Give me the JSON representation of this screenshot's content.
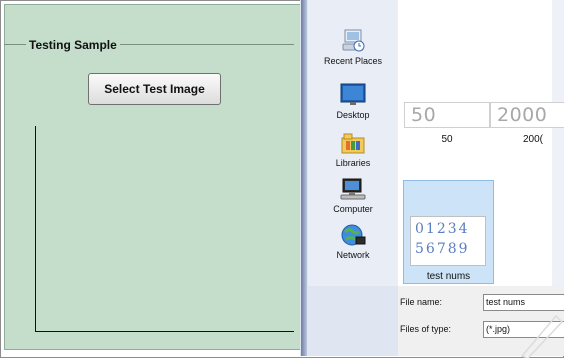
{
  "app": {
    "group_title": "Testing Sample",
    "select_button_label": "Select Test Image"
  },
  "dialog": {
    "places": [
      {
        "label": "Recent Places",
        "icon": "recent-places-icon"
      },
      {
        "label": "Desktop",
        "icon": "desktop-icon"
      },
      {
        "label": "Libraries",
        "icon": "libraries-icon"
      },
      {
        "label": "Computer",
        "icon": "computer-icon"
      },
      {
        "label": "Network",
        "icon": "network-icon"
      }
    ],
    "files": [
      {
        "preview": "50",
        "name": "50"
      },
      {
        "preview": "2000",
        "name": "200("
      }
    ],
    "selected_file": {
      "preview_line1": "01234",
      "preview_line2": "56789",
      "name": "test nums"
    },
    "file_name_label": "File name:",
    "file_name_value": "test nums",
    "file_type_label": "Files of type:",
    "file_type_value": "(*.jpg)"
  },
  "colors": {
    "panel_bg": "#c4decb",
    "dialog_bg": "#dfe6f1",
    "selection_bg": "#cde3f7"
  }
}
